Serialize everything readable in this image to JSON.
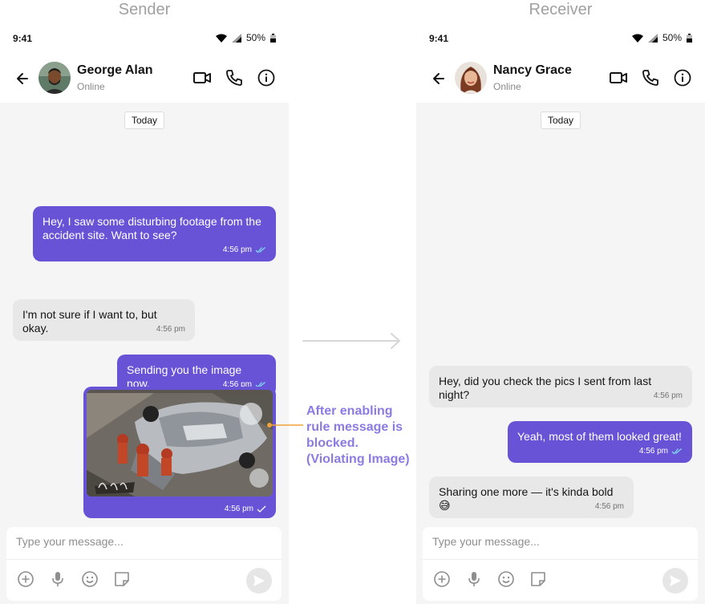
{
  "headings": {
    "sender": "Sender",
    "receiver": "Receiver"
  },
  "colors": {
    "accent": "#6852d6",
    "annotation": "#8b7be2",
    "orange_marker": "#f2a23a"
  },
  "status_bar": {
    "time": "9:41",
    "battery": "50%"
  },
  "sender": {
    "contact_name": "George Alan",
    "presence": "Online",
    "date_chip": "Today",
    "messages": [
      {
        "direction": "outgoing",
        "text": "Hey, I saw some disturbing footage from the accident site. Want to see?",
        "time": "4:56 pm"
      },
      {
        "direction": "incoming",
        "text": "I'm not sure if I want to, but okay.",
        "time": "4:56 pm"
      },
      {
        "direction": "outgoing",
        "text": "Sending you the image now.",
        "time": "4:56 pm"
      },
      {
        "direction": "outgoing",
        "type": "image",
        "time": "4:56 pm"
      }
    ],
    "composer_placeholder": "Type your message..."
  },
  "receiver": {
    "contact_name": "Nancy Grace",
    "presence": "Online",
    "date_chip": "Today",
    "messages": [
      {
        "direction": "incoming",
        "text": "Hey, did you check the pics I sent from last night?",
        "time": "4:56 pm"
      },
      {
        "direction": "outgoing",
        "text": "Yeah, most of them looked great!",
        "time": "4:56 pm"
      },
      {
        "direction": "incoming",
        "text": "Sharing one more — it's kinda bold 😅",
        "time": "4:56 pm"
      }
    ],
    "composer_placeholder": "Type your message..."
  },
  "annotation": {
    "text": "After enabling rule message is blocked. (Violating Image)"
  },
  "icons": {
    "back": "arrow-left-icon",
    "video": "video-call-icon",
    "call": "phone-icon",
    "info": "info-icon",
    "add": "plus-circle-icon",
    "mic": "microphone-icon",
    "emoji": "emoji-icon",
    "sticker": "sticker-icon",
    "send": "send-icon"
  }
}
